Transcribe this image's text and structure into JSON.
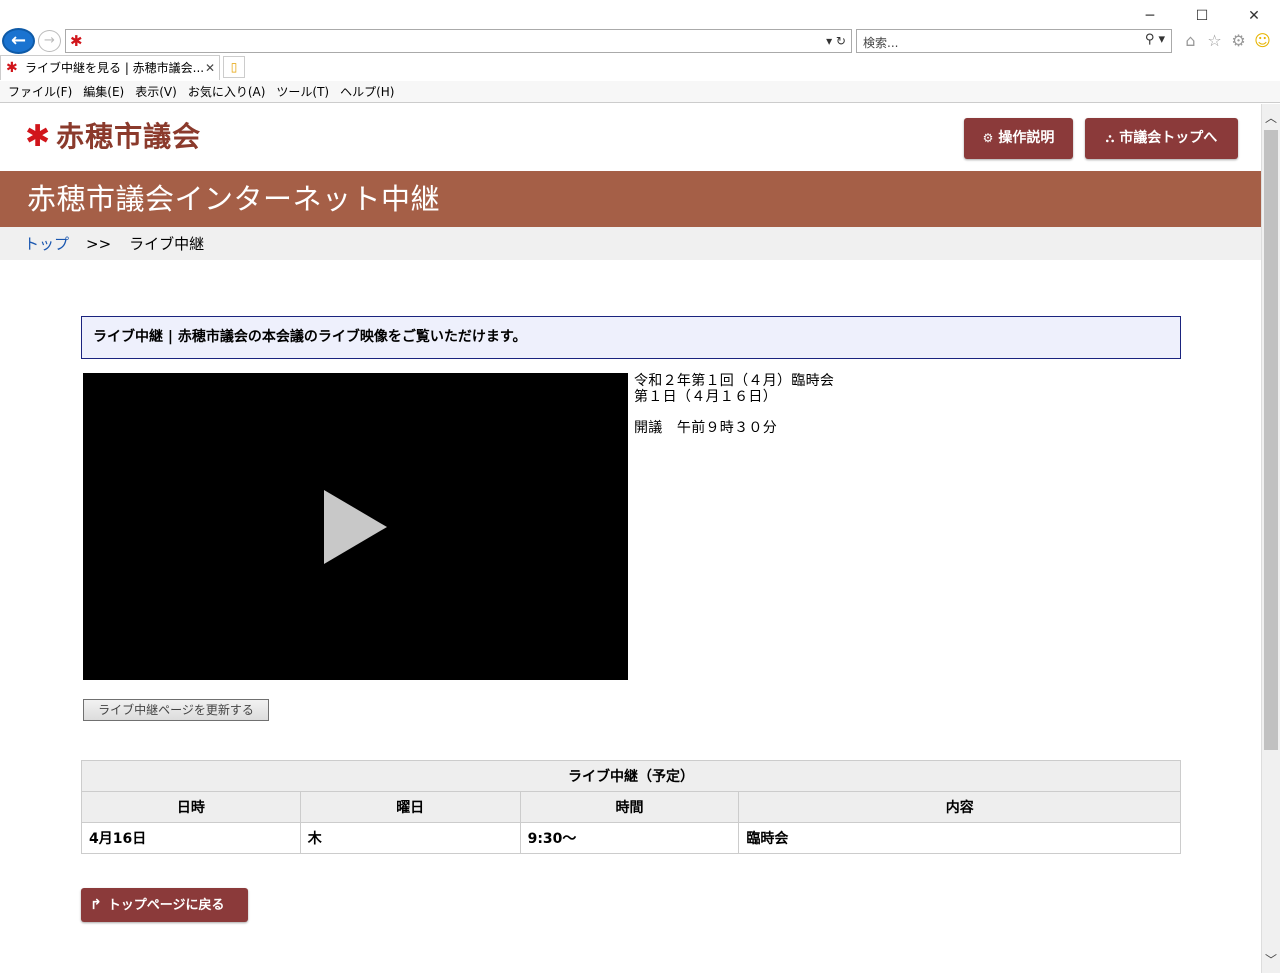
{
  "browser": {
    "window_controls": {
      "minimize": "─",
      "maximize": "☐",
      "close": "✕"
    },
    "back_glyph": "←",
    "forward_glyph": "→",
    "address_favicon": "✱",
    "address_tools": "▾ ↻",
    "search_placeholder": "検索...",
    "search_tools": "⚲ ▾",
    "tab_title": "ライブ中継を見る | 赤穂市議会...",
    "tab_close": "✕",
    "menu": [
      "ファイル(F)",
      "編集(E)",
      "表示(V)",
      "お気に入り(A)",
      "ツール(T)",
      "ヘルプ(H)"
    ],
    "icons": [
      "home-icon",
      "star-icon",
      "gear-icon",
      "smiley-icon"
    ]
  },
  "header": {
    "logo_mark": "✱",
    "logo_text": "赤穂市議会",
    "help_button": "操作説明",
    "help_icon": "⚙",
    "top_button": "市議会トップへ",
    "top_icon": "⛬"
  },
  "banner": {
    "title": "赤穂市議会インターネット中継"
  },
  "breadcrumb": {
    "home": "トップ",
    "separator": ">>",
    "current": "ライブ中継"
  },
  "notice": {
    "text": "ライブ中継 | 赤穂市議会の本会議のライブ映像をご覧いただけます。"
  },
  "session": {
    "line1": "令和２年第１回（４月）臨時会",
    "line2": "第１日（４月１６日）",
    "line3": "開議　午前９時３０分"
  },
  "refresh_button": "ライブ中継ページを更新する",
  "schedule": {
    "caption": "ライブ中継（予定）",
    "headers": [
      "日時",
      "曜日",
      "時間",
      "内容"
    ],
    "rows": [
      [
        "4月16日",
        "木",
        "9:30～",
        "臨時会"
      ]
    ]
  },
  "back_button": {
    "label": "トップページに戻る",
    "icon": "↱"
  },
  "colors": {
    "brand": "#8b3a3a",
    "banner": "#a55f47",
    "link": "#1a57b0",
    "notice_border": "#1a237e"
  }
}
